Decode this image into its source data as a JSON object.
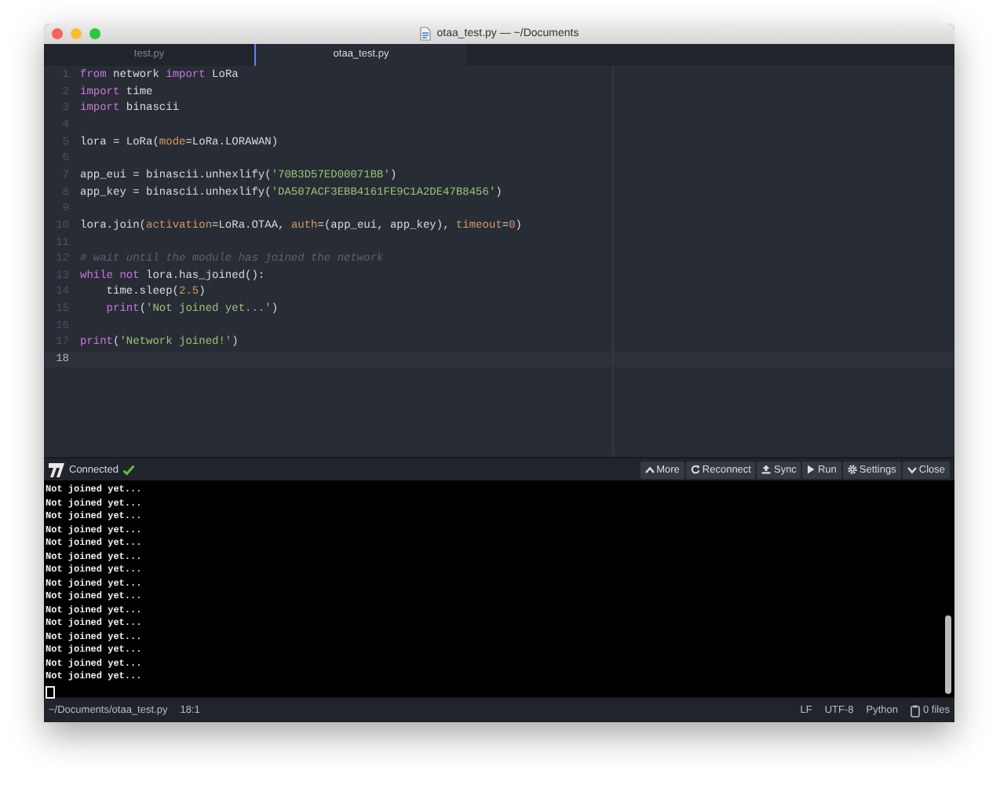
{
  "window": {
    "title": "otaa_test.py — ~/Documents"
  },
  "tabs": [
    {
      "label": "test.py",
      "selected": false
    },
    {
      "label": "otaa_test.py",
      "selected": true
    }
  ],
  "editor": {
    "lines": [
      {
        "number": "1",
        "current": false,
        "indented": false,
        "tokens": [
          {
            "kind": "kw",
            "text": "from"
          },
          {
            "kind": "plain",
            "text": " network "
          },
          {
            "kind": "kw",
            "text": "import"
          },
          {
            "kind": "plain",
            "text": " LoRa"
          }
        ]
      },
      {
        "number": "2",
        "current": false,
        "indented": false,
        "tokens": [
          {
            "kind": "kw",
            "text": "import"
          },
          {
            "kind": "plain",
            "text": " time"
          }
        ]
      },
      {
        "number": "3",
        "current": false,
        "indented": false,
        "tokens": [
          {
            "kind": "kw",
            "text": "import"
          },
          {
            "kind": "plain",
            "text": " binascii"
          }
        ]
      },
      {
        "number": "4",
        "current": false
      },
      {
        "number": "5",
        "current": false,
        "indented": false,
        "tokens": [
          {
            "kind": "plain",
            "text": "lora = LoRa("
          },
          {
            "kind": "param",
            "text": "mode"
          },
          {
            "kind": "plain",
            "text": "=LoRa.LORAWAN)"
          }
        ]
      },
      {
        "number": "6",
        "current": false
      },
      {
        "number": "7",
        "current": false,
        "indented": false,
        "tokens": [
          {
            "kind": "plain",
            "text": "app_eui = binascii.unhexlify("
          },
          {
            "kind": "str",
            "text": "'70B3D57ED00071BB'"
          },
          {
            "kind": "plain",
            "text": ")"
          }
        ]
      },
      {
        "number": "8",
        "current": false,
        "indented": false,
        "tokens": [
          {
            "kind": "plain",
            "text": "app_key = binascii.unhexlify("
          },
          {
            "kind": "str",
            "text": "'DA507ACF3EBB4161FE9C1A2DE47B8456'"
          },
          {
            "kind": "plain",
            "text": ")"
          }
        ]
      },
      {
        "number": "9",
        "current": false
      },
      {
        "number": "10",
        "current": false,
        "indented": false,
        "tokens": [
          {
            "kind": "plain",
            "text": "lora.join("
          },
          {
            "kind": "param",
            "text": "activation"
          },
          {
            "kind": "plain",
            "text": "=LoRa.OTAA, "
          },
          {
            "kind": "param",
            "text": "auth"
          },
          {
            "kind": "plain",
            "text": "=(app_eui, app_key), "
          },
          {
            "kind": "param",
            "text": "timeout"
          },
          {
            "kind": "plain",
            "text": "="
          },
          {
            "kind": "num",
            "text": "0"
          },
          {
            "kind": "plain",
            "text": ")"
          }
        ]
      },
      {
        "number": "11",
        "current": false
      },
      {
        "number": "12",
        "current": false,
        "indented": false,
        "tokens": [
          {
            "kind": "comment",
            "text": "# wait until the module has joined the network"
          }
        ]
      },
      {
        "number": "13",
        "current": false,
        "indented": false,
        "tokens": [
          {
            "kind": "kw",
            "text": "while not"
          },
          {
            "kind": "plain",
            "text": " lora.has_joined():"
          }
        ]
      },
      {
        "number": "14",
        "current": false,
        "indented": true,
        "tokens": [
          {
            "kind": "plain",
            "text": "time.sleep("
          },
          {
            "kind": "num",
            "text": "2.5"
          },
          {
            "kind": "plain",
            "text": ")"
          }
        ]
      },
      {
        "number": "15",
        "current": false,
        "indented": true,
        "tokens": [
          {
            "kind": "kw",
            "text": "print"
          },
          {
            "kind": "plain",
            "text": "("
          },
          {
            "kind": "str",
            "text": "'Not joined yet...'"
          },
          {
            "kind": "plain",
            "text": ")"
          }
        ]
      },
      {
        "number": "16",
        "current": false
      },
      {
        "number": "17",
        "current": false,
        "indented": false,
        "tokens": [
          {
            "kind": "kw",
            "text": "print"
          },
          {
            "kind": "plain",
            "text": "("
          },
          {
            "kind": "str",
            "text": "'Network joined!'"
          },
          {
            "kind": "plain",
            "text": ")"
          }
        ]
      },
      {
        "number": "18",
        "current": true
      }
    ]
  },
  "toolbar": {
    "status": "Connected",
    "connected": true,
    "buttons": [
      {
        "kind": "more",
        "label": "More"
      },
      {
        "kind": "reconnect",
        "label": "Reconnect"
      },
      {
        "kind": "sync",
        "label": "Sync"
      },
      {
        "kind": "run",
        "label": "Run"
      },
      {
        "kind": "settings",
        "label": "Settings"
      },
      {
        "kind": "close",
        "label": "Close"
      }
    ]
  },
  "terminal": {
    "lines": [
      "Not joined yet...",
      "Not joined yet...",
      "Not joined yet...",
      "Not joined yet...",
      "Not joined yet...",
      "Not joined yet...",
      "Not joined yet...",
      "Not joined yet...",
      "Not joined yet...",
      "Not joined yet...",
      "Not joined yet...",
      "Not joined yet...",
      "Not joined yet...",
      "Not joined yet...",
      "Not joined yet..."
    ]
  },
  "status_bar": {
    "path": "~/Documents/otaa_test.py",
    "position": "18:1",
    "line_ending": "LF",
    "encoding": "UTF-8",
    "grammar": "Python",
    "files": "0 files"
  }
}
